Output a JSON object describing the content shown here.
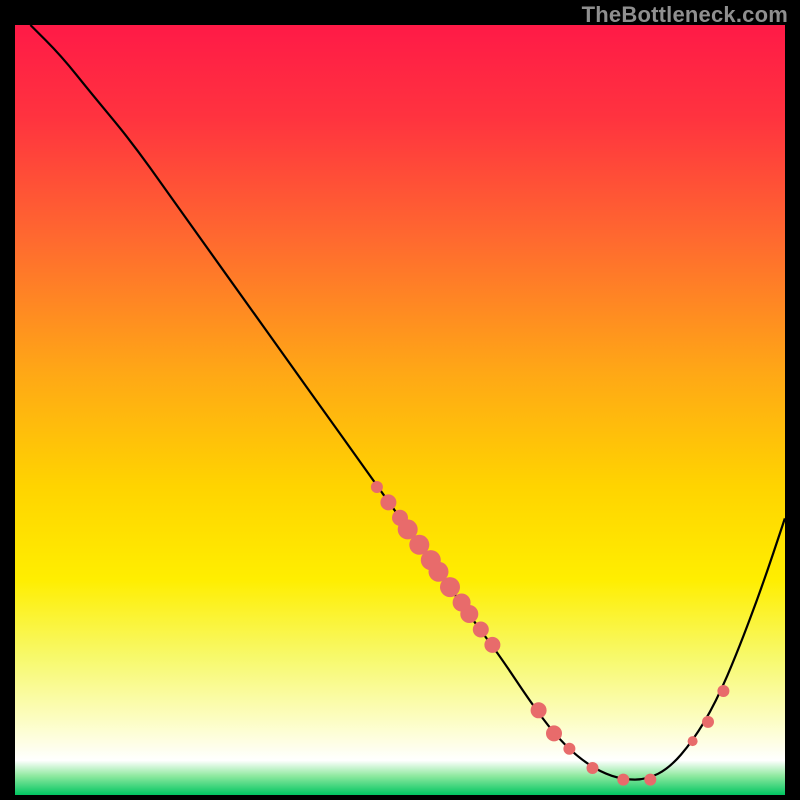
{
  "watermark": "TheBottleneck.com",
  "colors": {
    "curve": "#000000",
    "dot": "#e86b6b",
    "gradient_stops": [
      {
        "offset": 0.0,
        "color": "#ff1a47"
      },
      {
        "offset": 0.12,
        "color": "#ff333f"
      },
      {
        "offset": 0.28,
        "color": "#ff6a2f"
      },
      {
        "offset": 0.45,
        "color": "#ffa716"
      },
      {
        "offset": 0.6,
        "color": "#ffd400"
      },
      {
        "offset": 0.72,
        "color": "#ffee00"
      },
      {
        "offset": 0.82,
        "color": "#f7f96a"
      },
      {
        "offset": 0.9,
        "color": "#fcfdc0"
      },
      {
        "offset": 0.955,
        "color": "#ffffff"
      },
      {
        "offset": 0.975,
        "color": "#8fe9a0"
      },
      {
        "offset": 1.0,
        "color": "#00c561"
      }
    ]
  },
  "chart_data": {
    "type": "line",
    "title": "",
    "xlabel": "",
    "ylabel": "",
    "xlim": [
      0,
      100
    ],
    "ylim": [
      0,
      100
    ],
    "series": [
      {
        "name": "bottleneck-curve",
        "x": [
          2,
          6,
          10,
          15,
          20,
          25,
          30,
          35,
          40,
          45,
          50,
          55,
          60,
          63,
          67,
          70,
          73,
          76,
          79,
          82,
          85,
          88,
          91,
          94,
          97,
          100
        ],
        "y": [
          100,
          96,
          91,
          85,
          78,
          71,
          64,
          57,
          50,
          43,
          36,
          29,
          22,
          18,
          12,
          8,
          5,
          3,
          2,
          2,
          3.5,
          7,
          12,
          19,
          27,
          36
        ]
      }
    ],
    "dots": {
      "name": "highlight-points",
      "x": [
        47,
        48.5,
        50,
        51,
        52.5,
        54,
        55,
        56.5,
        58,
        59,
        60.5,
        62,
        68,
        70,
        72,
        75,
        79,
        82.5,
        88,
        90,
        92
      ],
      "y": [
        40,
        38,
        36,
        34.5,
        32.5,
        30.5,
        29,
        27,
        25,
        23.5,
        21.5,
        19.5,
        11,
        8,
        6,
        3.5,
        2,
        2,
        7,
        9.5,
        13.5
      ],
      "r": [
        6,
        8,
        8,
        10,
        10,
        10,
        10,
        10,
        9,
        9,
        8,
        8,
        8,
        8,
        6,
        6,
        6,
        6,
        5,
        6,
        6
      ]
    }
  }
}
